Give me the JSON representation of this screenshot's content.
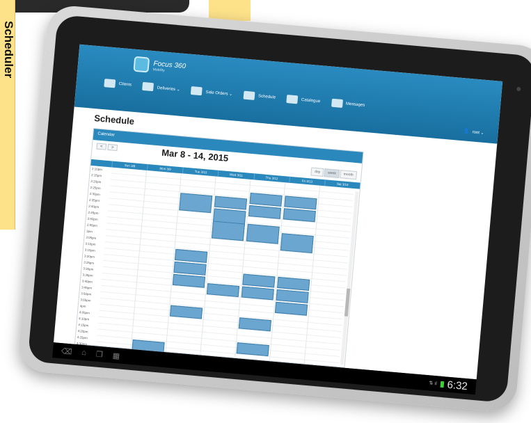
{
  "side_banner": {
    "label": "Scheduler"
  },
  "app": {
    "logo": {
      "name": "Focus 360",
      "sub": "Mobility"
    },
    "nav": [
      {
        "label": "Clients",
        "icon": "clients-icon"
      },
      {
        "label": "Deliveries ⌄",
        "icon": "truck-icon"
      },
      {
        "label": "Sale Orders ⌄",
        "icon": "cart-icon"
      },
      {
        "label": "Schedule",
        "icon": "schedule-icon"
      },
      {
        "label": "Catalogue",
        "icon": "catalogue-icon"
      },
      {
        "label": "Messages",
        "icon": "messages-icon"
      }
    ],
    "user": {
      "label": "root ⌄",
      "icon": "👤"
    },
    "page_title": "Schedule"
  },
  "calendar": {
    "panel_title": "Calendar",
    "prev": "<",
    "next": ">",
    "range_title": "Mar 8 - 14, 2015",
    "views": [
      "day",
      "week",
      "month"
    ],
    "active_view": "week",
    "days": [
      "Sun 3/8",
      "Mon 3/9",
      "Tue 3/10",
      "Wed 3/11",
      "Thu 3/12",
      "Fri 3/13",
      "Sat 3/14"
    ],
    "times": [
      "2:10pm",
      "2:15pm",
      "2:20pm",
      "2:25pm",
      "2:30pm",
      "2:35pm",
      "2:40pm",
      "2:45pm",
      "2:50pm",
      "2:55pm",
      "3pm",
      "3:05pm",
      "3:10pm",
      "3:15pm",
      "3:20pm",
      "3:25pm",
      "3:30pm",
      "3:35pm",
      "3:40pm",
      "3:45pm",
      "3:50pm",
      "3:55pm",
      "4pm",
      "4:05pm",
      "4:10pm",
      "4:15pm",
      "4:20pm",
      "4:25pm",
      "4:30pm"
    ]
  },
  "system_bar": {
    "nav_icons": [
      "back-icon",
      "home-icon",
      "recent-apps-icon",
      "grid-icon"
    ],
    "status": "⇅ ıl",
    "clock": "6:32"
  },
  "colors": {
    "header": "#2a8bc0",
    "event": "#6aa6cf",
    "side_banner": "#fde28a"
  }
}
